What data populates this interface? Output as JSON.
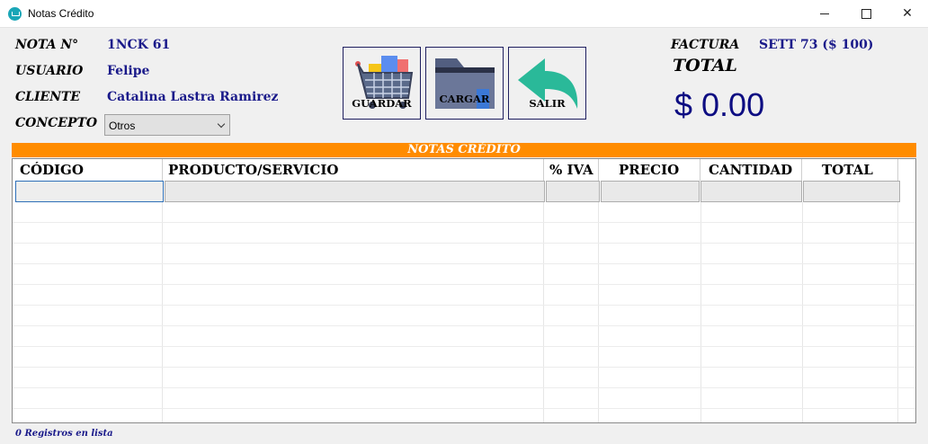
{
  "window": {
    "title": "Notas Crédito"
  },
  "header": {
    "nota_label": "NOTA N°",
    "nota_value": "1NCK 61",
    "usuario_label": "USUARIO",
    "usuario_value": "Felipe",
    "cliente_label": "CLIENTE",
    "cliente_value": "Catalina Lastra Ramirez",
    "concepto_label": "CONCEPTO",
    "concepto_value": "Otros",
    "factura_label": "FACTURA",
    "factura_value": "SETT 73  ($ 100)",
    "total_label": "TOTAL",
    "total_value": "$ 0.00"
  },
  "toolbar": {
    "guardar_label": "GUARDAR",
    "cargar_label": "CARGAR",
    "salir_label": "SALIR"
  },
  "banner": "NOTAS CRÉDITO",
  "table": {
    "columns": [
      "CÓDIGO",
      "PRODUCTO/SERVICIO",
      "% IVA",
      "PRECIO",
      "CANTIDAD",
      "TOTAL"
    ],
    "rows": []
  },
  "status": "0 Registros en lista",
  "colors": {
    "accent_orange": "#ff8c00",
    "text_blue": "#1a1a8a",
    "total_blue": "#0d0d82"
  }
}
